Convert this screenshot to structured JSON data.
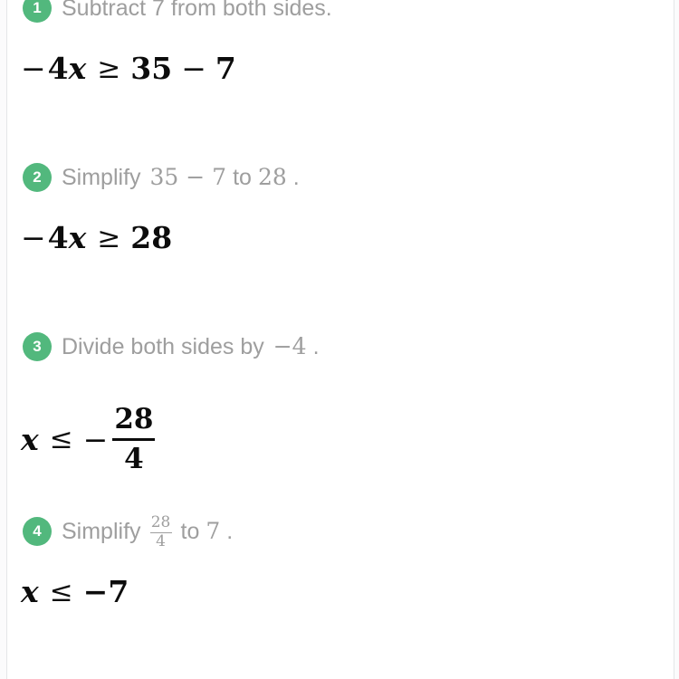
{
  "page": {
    "background_color": "#ffffff",
    "badge_color": "#52b87d",
    "instruction_color": "#9e9e9e",
    "expression_color": "#0c0c0c"
  },
  "steps": [
    {
      "number": "1",
      "instruction_prefix": "Subtract 7 from both sides.",
      "expression": {
        "lhs_neg": "−",
        "lhs_coeff": "4",
        "lhs_var": "x",
        "relation": "≥",
        "rhs_a": "35",
        "rhs_op": "−",
        "rhs_b": "7"
      }
    },
    {
      "number": "2",
      "instruction_prefix": "Simplify",
      "inline_math_1": "35 − 7",
      "instruction_middle": "to",
      "inline_math_2": "28",
      "instruction_suffix": ".",
      "expression": {
        "lhs_neg": "−",
        "lhs_coeff": "4",
        "lhs_var": "x",
        "relation": "≥",
        "rhs": "28"
      }
    },
    {
      "number": "3",
      "instruction_prefix": "Divide both sides by",
      "inline_math_1": "−4",
      "instruction_suffix": ".",
      "expression": {
        "lhs_var": "x",
        "relation": "≤",
        "rhs_neg": "−",
        "fraction_numerator": "28",
        "fraction_denominator": "4"
      }
    },
    {
      "number": "4",
      "instruction_prefix": "Simplify",
      "inline_fraction_numerator": "28",
      "inline_fraction_denominator": "4",
      "instruction_middle": "to",
      "inline_math_2": "7",
      "instruction_suffix": ".",
      "expression": {
        "lhs_var": "x",
        "relation": "≤",
        "rhs": "−7"
      }
    }
  ]
}
